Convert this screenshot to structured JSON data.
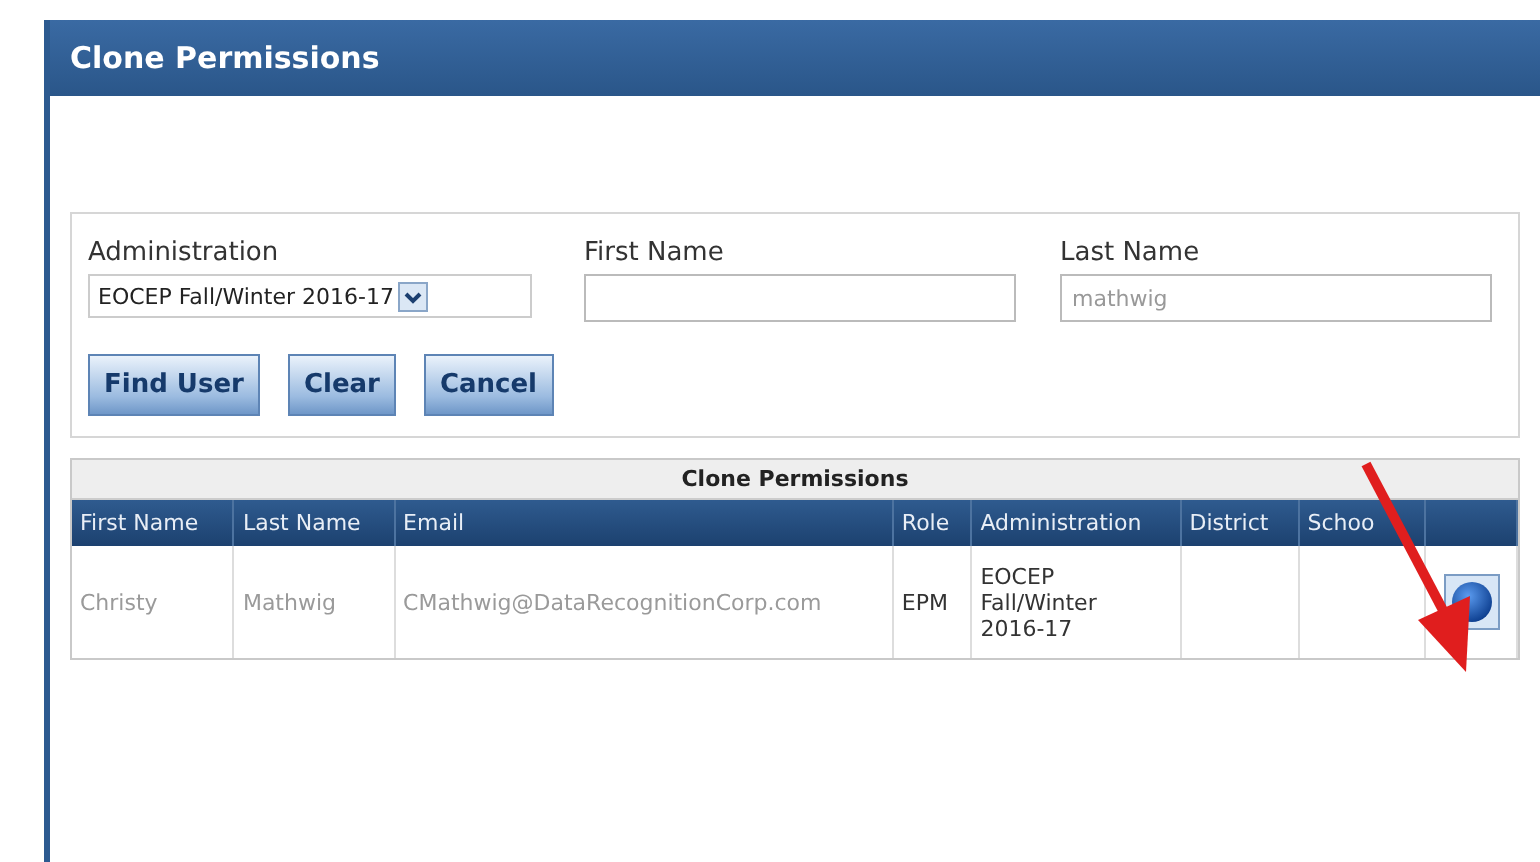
{
  "window": {
    "title": "Clone Permissions"
  },
  "filters": [
    {
      "kind": "select",
      "label": "Administration",
      "value": "EOCEP Fall/Winter 2016-17"
    },
    {
      "kind": "text",
      "label": "First Name"
    },
    {
      "kind": "text",
      "label": "Last Name",
      "value": "mathwig"
    }
  ],
  "buttons": [
    "Find User",
    "Clear",
    "Cancel"
  ],
  "table": {
    "caption": "Clone Permissions",
    "columns": [
      "First Name",
      "Last Name",
      "Email",
      "Role",
      "Administration",
      "District",
      "Schoo"
    ],
    "rows": [
      {
        "cells": [
          "Christy",
          "Mathwig",
          "CMathwig@DataRecognitionCorp.com",
          "EPM",
          "EOCEP Fall/Winter 2016-17",
          "",
          ""
        ],
        "has_button": true
      }
    ]
  }
}
